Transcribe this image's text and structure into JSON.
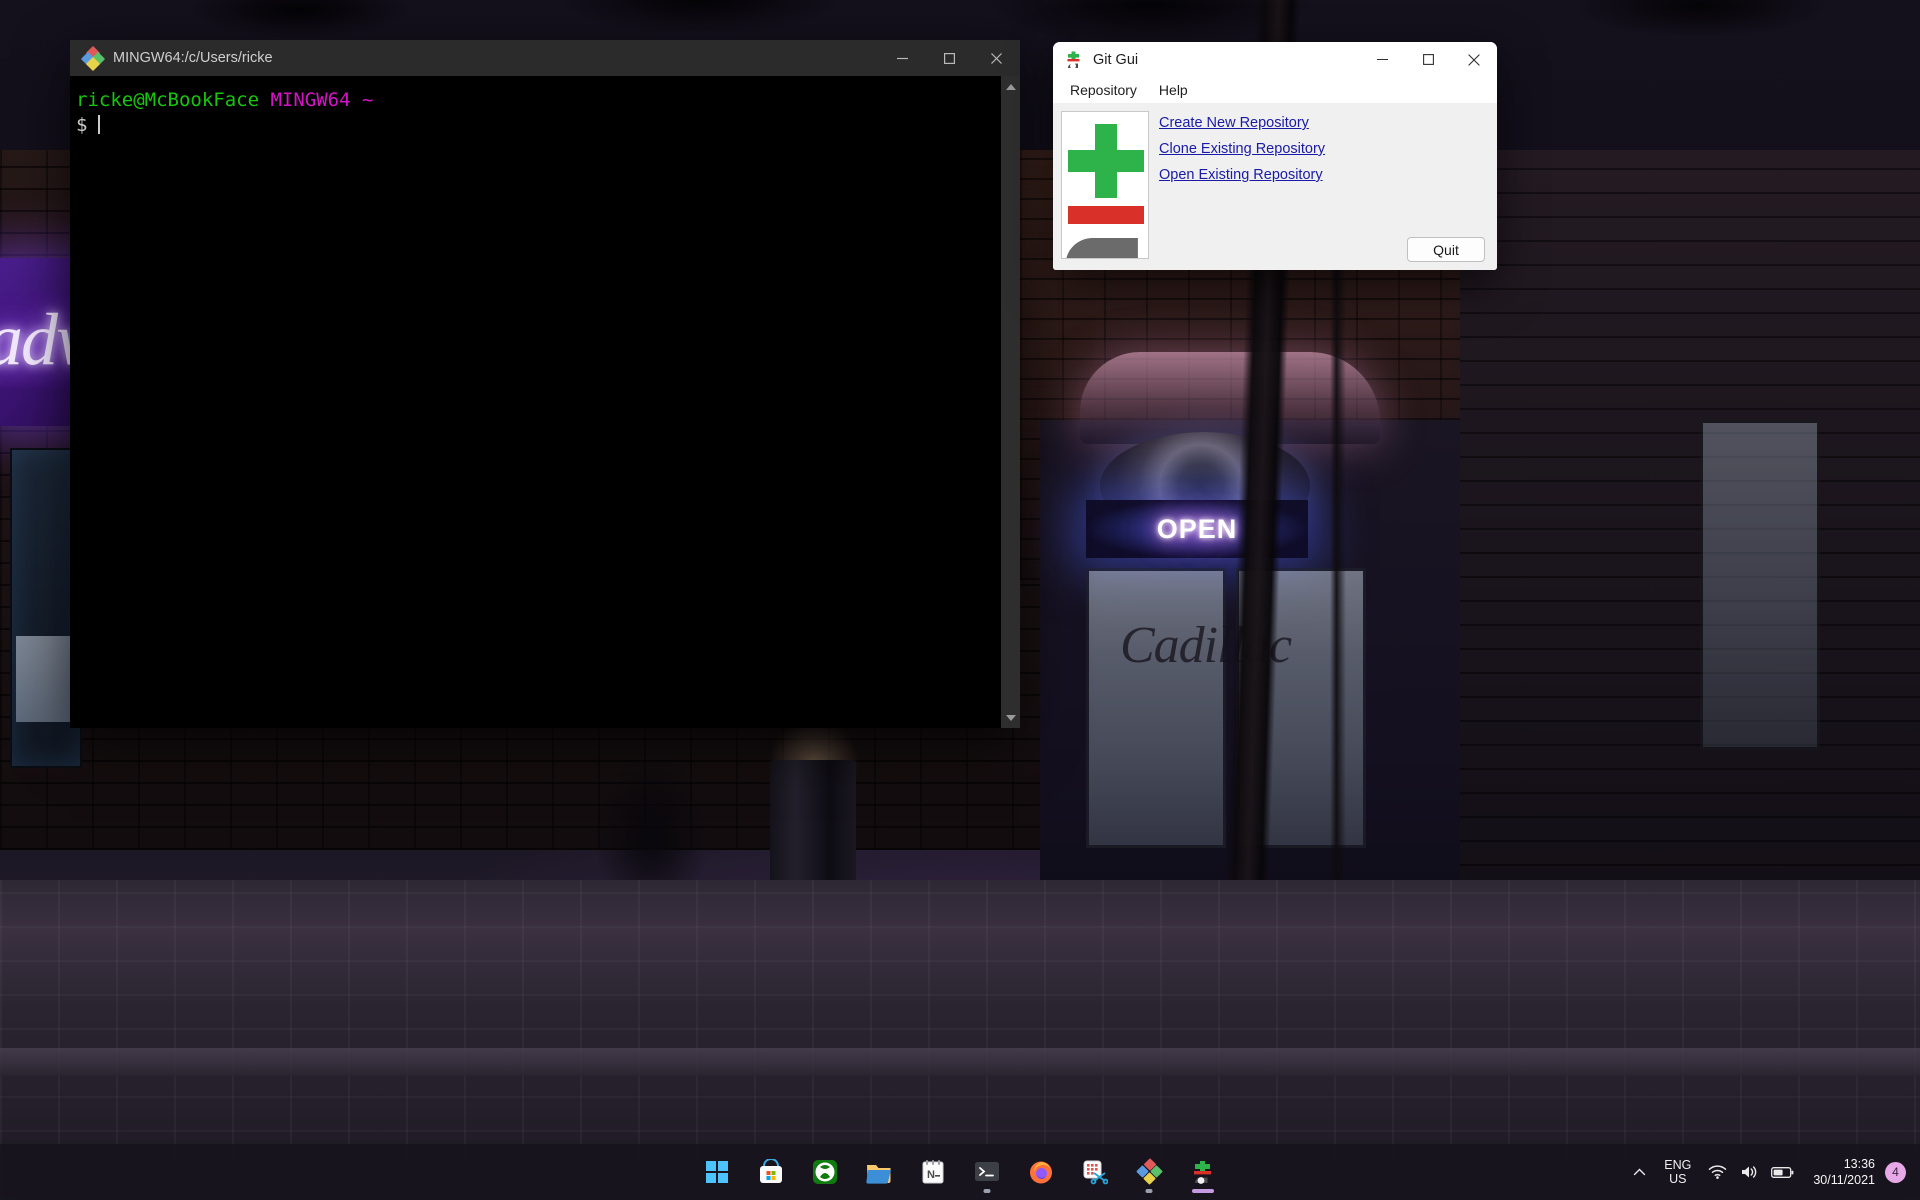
{
  "terminal": {
    "title": "MINGW64:/c/Users/ricke",
    "icon": "git-bash-diamond-icon",
    "prompt_user": "ricke@McBookFace",
    "prompt_shell": "MINGW64 ~",
    "prompt_symbol": "$",
    "command_line": "",
    "controls": {
      "minimize": "minimize",
      "maximize": "maximize",
      "close": "close"
    }
  },
  "git_gui": {
    "title": "Git Gui",
    "icon": "git-gui-icon",
    "menus": [
      "Repository",
      "Help"
    ],
    "links": [
      "Create New Repository",
      "Clone Existing Repository",
      "Open Existing Repository"
    ],
    "quit_label": "Quit",
    "controls": {
      "minimize": "minimize",
      "maximize": "maximize",
      "close": "close"
    }
  },
  "desktop": {
    "wallpaper_neon_open": "OPEN",
    "wallpaper_neon_script": "adw",
    "wallpaper_store_script": "Cadillac"
  },
  "taskbar": {
    "apps": [
      {
        "name": "start-button",
        "label": "Start",
        "indicator": "none"
      },
      {
        "name": "microsoft-store",
        "label": "Microsoft Store",
        "indicator": "none"
      },
      {
        "name": "xbox",
        "label": "Xbox",
        "indicator": "none"
      },
      {
        "name": "file-explorer",
        "label": "File Explorer",
        "indicator": "none"
      },
      {
        "name": "notepad",
        "label": "Notepad",
        "indicator": "none"
      },
      {
        "name": "terminal",
        "label": "Windows Terminal",
        "indicator": "dot"
      },
      {
        "name": "firefox",
        "label": "Firefox",
        "indicator": "none"
      },
      {
        "name": "snipping-tool",
        "label": "Snipping Tool",
        "indicator": "none"
      },
      {
        "name": "git-bash",
        "label": "Git Bash",
        "indicator": "dot"
      },
      {
        "name": "git-gui",
        "label": "Git Gui",
        "indicator": "active"
      }
    ],
    "tray": {
      "overflow": "show-hidden-icons",
      "language_line1": "ENG",
      "language_line2": "US",
      "network": "wifi-icon",
      "volume": "volume-icon",
      "battery": "battery-icon",
      "time": "13:36",
      "date": "30/11/2021",
      "notification_count": "4"
    }
  },
  "colors": {
    "terminal_green": "#16c60c",
    "terminal_magenta": "#d414c4",
    "terminal_bg": "#000000",
    "link_blue": "#1a1aa8",
    "logo_green": "#2eb34a",
    "logo_red": "#d9302a",
    "logo_gray": "#6b6b6b",
    "badge_pink": "#e7a8e7",
    "taskbar_active": "#c49ae0"
  }
}
